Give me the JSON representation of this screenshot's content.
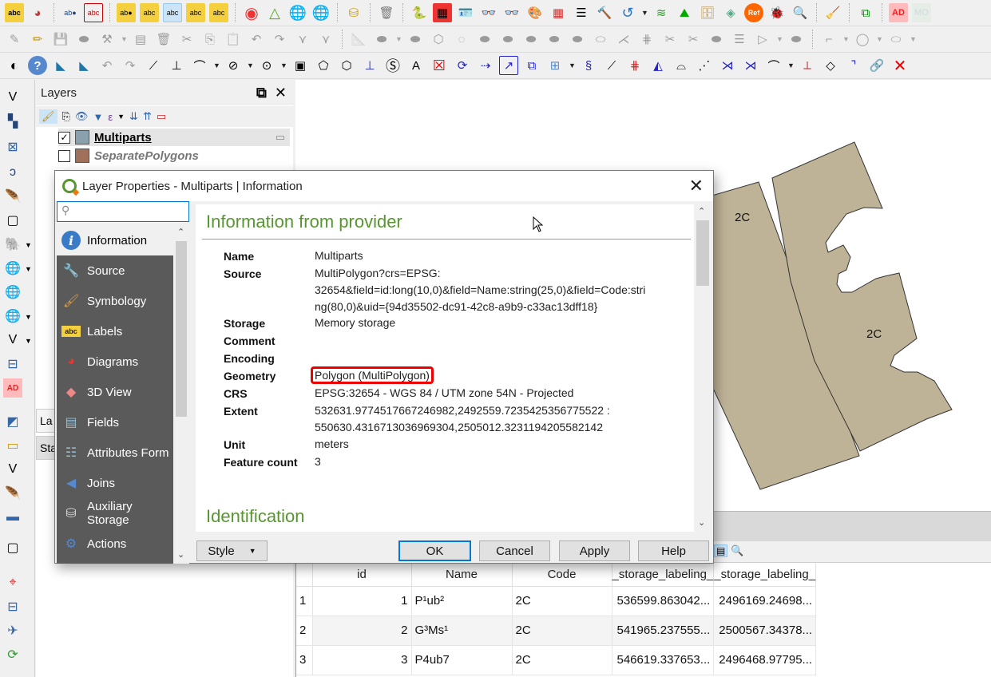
{
  "toolbars": {
    "row1_icons": [
      "label-abc-icon",
      "diagram-icon",
      "pin-label-icon",
      "unpin-label-icon",
      "highlight-pinned-icon",
      "show-hide-labels-icon",
      "move-label-icon",
      "rotate-label-icon",
      "change-label-icon",
      "heatmap-icon",
      "triangle-icon",
      "globe-dropdown-icon",
      "globe-search-icon",
      "db-gear-icon",
      "trash-bin-icon",
      "python-icon",
      "map-colors-icon",
      "id-card-icon",
      "glasses-icon",
      "glasses-blue-icon",
      "palette-icon",
      "grid-icon",
      "layers-hand-icon",
      "hammer-icon",
      "undo-blue-icon",
      "stack-icon",
      "terrain-icon",
      "archive-icon",
      "layers-green-icon",
      "ref-icon",
      "bug-icon",
      "magnify-doc-icon",
      "broom-icon",
      "copy-question-icon",
      "ad-icon",
      "mo-icon"
    ],
    "ref_label": "Ref",
    "ad_label": "AD"
  },
  "layers_panel": {
    "title": "Layers",
    "layers": [
      {
        "name": "Multiparts",
        "checked": true,
        "color": "#8aa0ac",
        "selected": true
      },
      {
        "name": "SeparatePolygons",
        "checked": false,
        "color": "#a0705a",
        "selected": false
      }
    ],
    "lower_tab_label": "La",
    "lower_tab2_label": "Sta"
  },
  "left_toolbar": {
    "ad_label": "AD"
  },
  "dialog": {
    "title": "Layer Properties - Multiparts | Information",
    "search_placeholder": "",
    "nav": [
      {
        "label": "Information",
        "icon": "info-icon",
        "selected": true
      },
      {
        "label": "Source",
        "icon": "wrench-icon"
      },
      {
        "label": "Symbology",
        "icon": "paintbrush-icon"
      },
      {
        "label": "Labels",
        "icon": "abc-label-icon"
      },
      {
        "label": "Diagrams",
        "icon": "pie-chart-icon"
      },
      {
        "label": "3D View",
        "icon": "cube-icon"
      },
      {
        "label": "Fields",
        "icon": "fields-table-icon"
      },
      {
        "label": "Attributes Form",
        "icon": "form-icon"
      },
      {
        "label": "Joins",
        "icon": "join-icon"
      },
      {
        "label": "Auxiliary Storage",
        "icon": "database-icon"
      },
      {
        "label": "Actions",
        "icon": "gear-play-icon"
      }
    ],
    "section1": "Information from provider",
    "section2": "Identification",
    "info": [
      {
        "key": "Name",
        "value": "Multiparts"
      },
      {
        "key": "Source",
        "value": "MultiPolygon?crs=EPSG:\n32654&field=id:long(10,0)&field=Name:string(25,0)&field=Code:stri\nng(80,0)&uid={94d35502-dc91-42c8-a9b9-c33ac13dff18}"
      },
      {
        "key": "Storage",
        "value": "Memory storage"
      },
      {
        "key": "Comment",
        "value": ""
      },
      {
        "key": "Encoding",
        "value": ""
      },
      {
        "key": "Geometry",
        "value": "Polygon (MultiPolygon)"
      },
      {
        "key": "CRS",
        "value": "EPSG:32654 - WGS 84 / UTM zone 54N - Projected"
      },
      {
        "key": "Extent",
        "value": "532631.9774517667246982,2492559.7235425356775522 :\n550630.4316713036969304,2505012.3231194205582142"
      },
      {
        "key": "Unit",
        "value": "meters"
      },
      {
        "key": "Feature count",
        "value": "3"
      }
    ],
    "buttons": {
      "style": "Style",
      "ok": "OK",
      "cancel": "Cancel",
      "apply": "Apply",
      "help": "Help"
    }
  },
  "map": {
    "fill_color": "#bfb397",
    "labels": [
      "2C",
      "2C"
    ]
  },
  "attribute_table": {
    "columns": [
      "id",
      "Name",
      "Code",
      "_storage_labeling_",
      "_storage_labeling_"
    ],
    "rows": [
      {
        "num": "1",
        "id": "1",
        "name": "P¹ub²",
        "code": "2C",
        "x": "536599.863042...",
        "y": "2496169.24698..."
      },
      {
        "num": "2",
        "id": "2",
        "name": "G³Ms¹",
        "code": "2C",
        "x": "541965.237555...",
        "y": "2500567.34378..."
      },
      {
        "num": "3",
        "id": "3",
        "name": "P4ub7",
        "code": "2C",
        "x": "546619.337653...",
        "y": "2496468.97795..."
      }
    ]
  }
}
